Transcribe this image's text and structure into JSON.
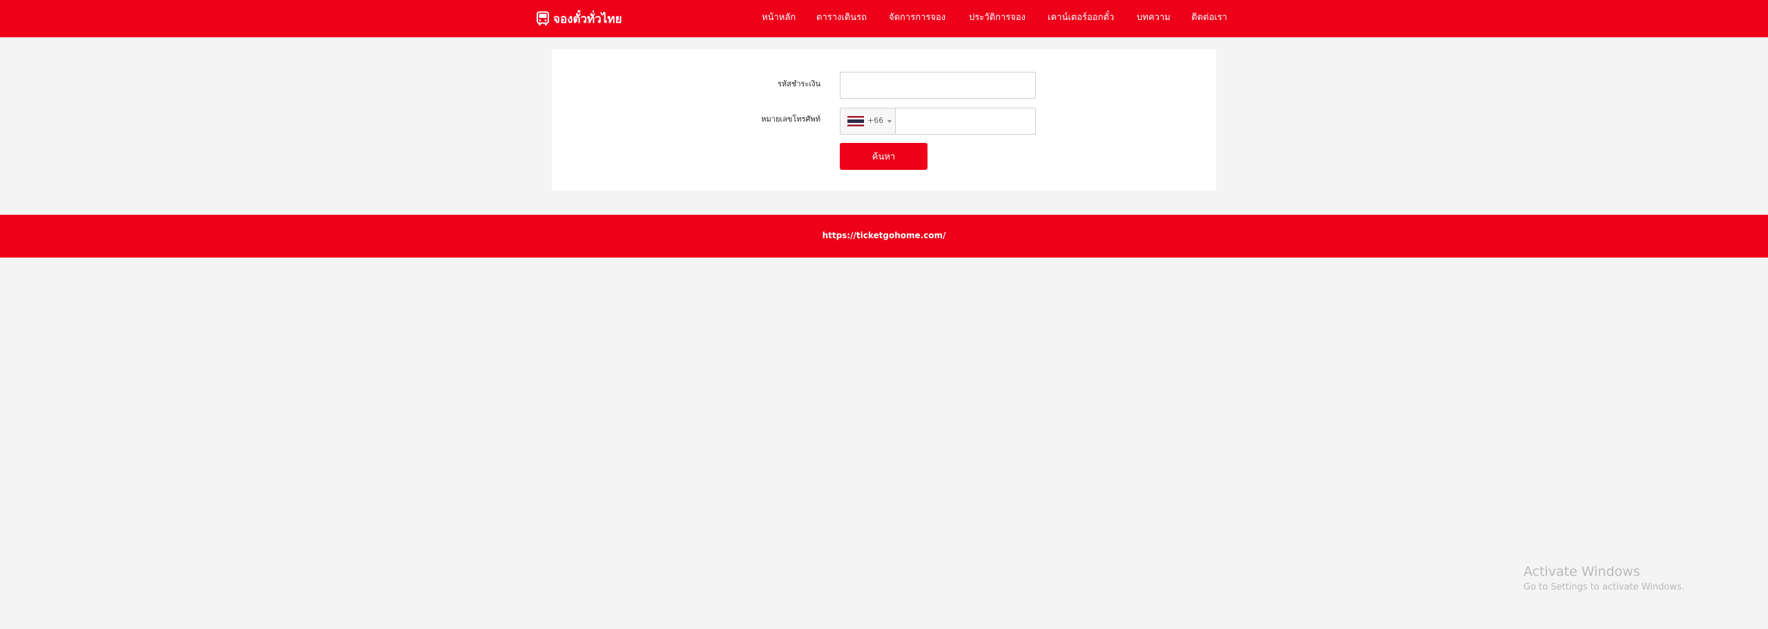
{
  "header": {
    "brand_name": "จองตั๋วทั่วไทย",
    "brand_icon": "bus-icon",
    "nav": [
      {
        "label": "หน้าหลัก"
      },
      {
        "label": "ตารางเดินรถ"
      },
      {
        "label": "จัดการการจอง"
      },
      {
        "label": "ประวัติการจอง"
      },
      {
        "label": "เคาน์เตอร์ออกตั๋ว"
      },
      {
        "label": "บทความ"
      },
      {
        "label": "ติดต่อเรา"
      }
    ]
  },
  "form": {
    "payment_code_label": "รหัสชำระเงิน",
    "payment_code_value": "",
    "phone_label": "หมายเลขโทรศัพท์",
    "country_flag": "thailand-flag-icon",
    "country_code": "+66",
    "phone_value": "",
    "search_label": "ค้นหา"
  },
  "footer": {
    "link_text": "https://ticketgohome.com/"
  },
  "watermark": {
    "title": "Activate Windows",
    "subtitle": "Go to Settings to activate Windows."
  },
  "colors": {
    "brand": "#ee0019",
    "background": "#f4f4f4"
  }
}
